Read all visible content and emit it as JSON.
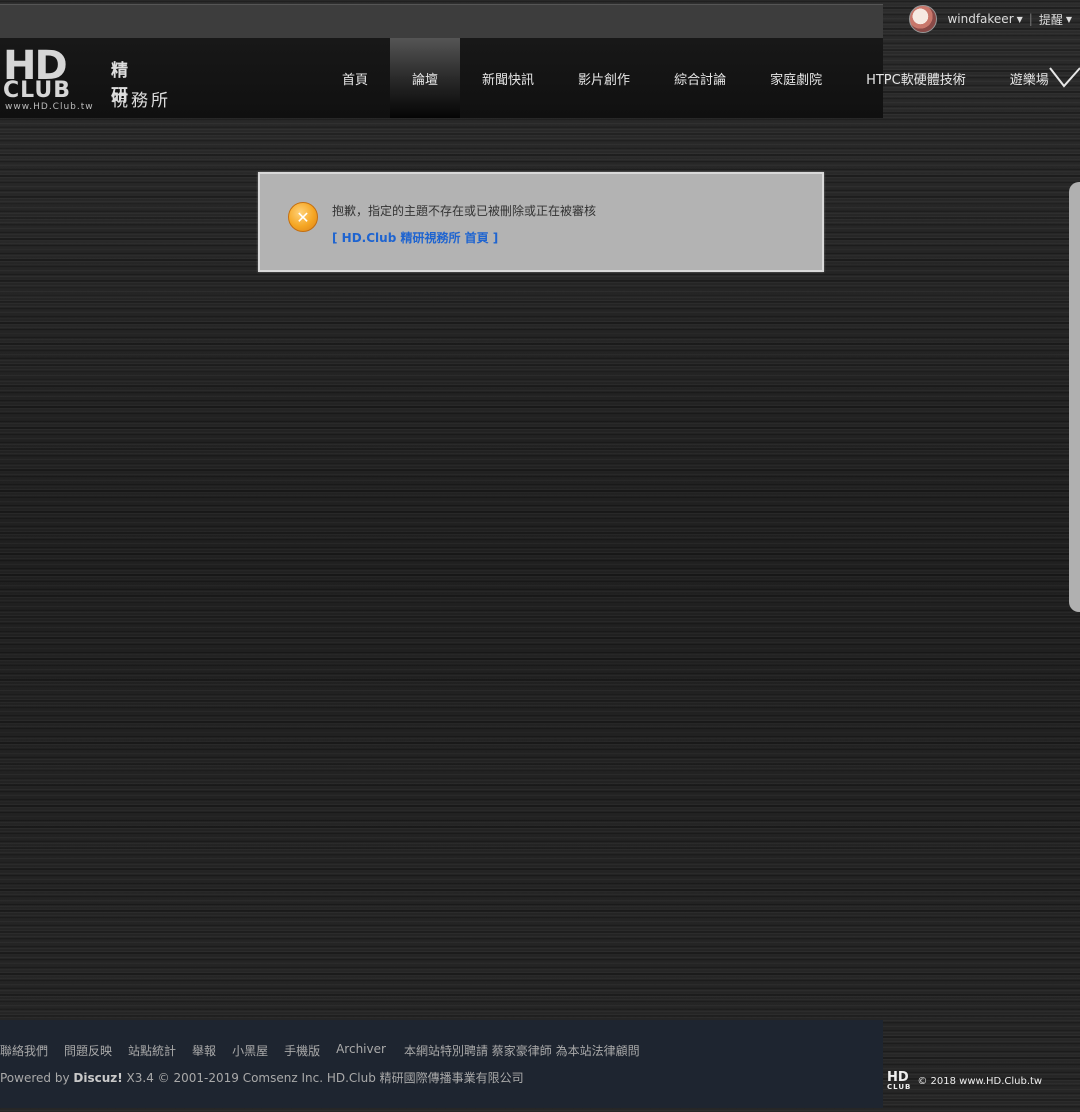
{
  "user": {
    "name": "windfakeer",
    "alerts_label": "提醒"
  },
  "logo": {
    "hd": "HD",
    "club": "CLUB",
    "url": "www.HD.Club.tw",
    "cn_line1": "精研",
    "cn_line2": "視務所"
  },
  "nav": {
    "items": [
      "首頁",
      "論壇",
      "新聞快訊",
      "影片創作",
      "綜合討論",
      "家庭劇院",
      "HTPC軟硬體技術",
      "遊樂場"
    ],
    "active_index": 1
  },
  "message": {
    "text": "抱歉，指定的主題不存在或已被刪除或正在被審核",
    "link": "[ HD.Club 精研視務所 首頁 ]"
  },
  "footer": {
    "links": [
      "聯絡我們",
      "問題反映",
      "站點統計",
      "舉報",
      "小黑屋",
      "手機版",
      "Archiver"
    ],
    "legal": "本網站特別聘請 蔡家豪律師 為本站法律顧問",
    "powered_prefix": "Powered by ",
    "powered_brand": "Discuz!",
    "powered_rest": " X3.4 © 2001-2019 Comsenz Inc.  HD.Club 精研國際傳播事業有限公司",
    "copyright": "© 2018 www.HD.Club.tw",
    "mini_logo_top": "HD",
    "mini_logo_bottom": "CLUB"
  },
  "colors": {
    "accent_link": "#1e64d0",
    "icon_orange": "#f5a623",
    "footer_bg": "#1e2530"
  }
}
